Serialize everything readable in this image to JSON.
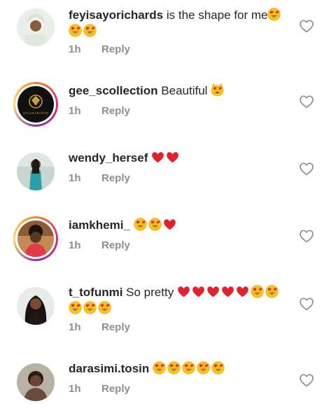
{
  "comments": [
    {
      "username": "feyisayorichards",
      "text": " is the shape for me",
      "time": "1h",
      "reply_label": "Reply",
      "emojis": [
        "heart-eyes-emoji",
        "heart-eyes-emoji",
        "heart-eyes-emoji"
      ]
    },
    {
      "username": "gee_scollection",
      "text": " Beautiful ",
      "time": "1h",
      "reply_label": "Reply",
      "avatar_caption": "G'S COLLECTION",
      "emojis": [
        "heart-eyes-cat-emoji"
      ]
    },
    {
      "username": "wendy_hersef",
      "text": " ",
      "time": "1h",
      "reply_label": "Reply",
      "emojis": [
        "red-heart-emoji",
        "red-heart-emoji"
      ]
    },
    {
      "username": "iamkhemi_",
      "text": " ",
      "time": "1h",
      "reply_label": "Reply",
      "emojis": [
        "heart-eyes-emoji",
        "heart-eyes-emoji",
        "red-heart-emoji"
      ]
    },
    {
      "username": "t_tofunmi",
      "text": " So pretty ",
      "time": "1h",
      "reply_label": "Reply",
      "emojis": [
        "red-heart-emoji",
        "red-heart-emoji",
        "red-heart-emoji",
        "red-heart-emoji",
        "red-heart-emoji",
        "heart-eyes-emoji",
        "heart-eyes-emoji",
        "heart-eyes-emoji",
        "heart-eyes-emoji",
        "heart-eyes-emoji"
      ]
    },
    {
      "username": "darasimi.tosin",
      "text": " ",
      "time": "1h",
      "reply_label": "Reply",
      "emojis": [
        "heart-eyes-emoji",
        "heart-eyes-emoji",
        "heart-eyes-emoji",
        "heart-eyes-emoji",
        "heart-eyes-emoji"
      ]
    }
  ],
  "icons": {
    "like": "heart-outline-icon"
  },
  "colors": {
    "username": "#262626",
    "meta": "#8e8e8e",
    "heart": "#e0222f",
    "emoji_face": "#fcc21b"
  }
}
